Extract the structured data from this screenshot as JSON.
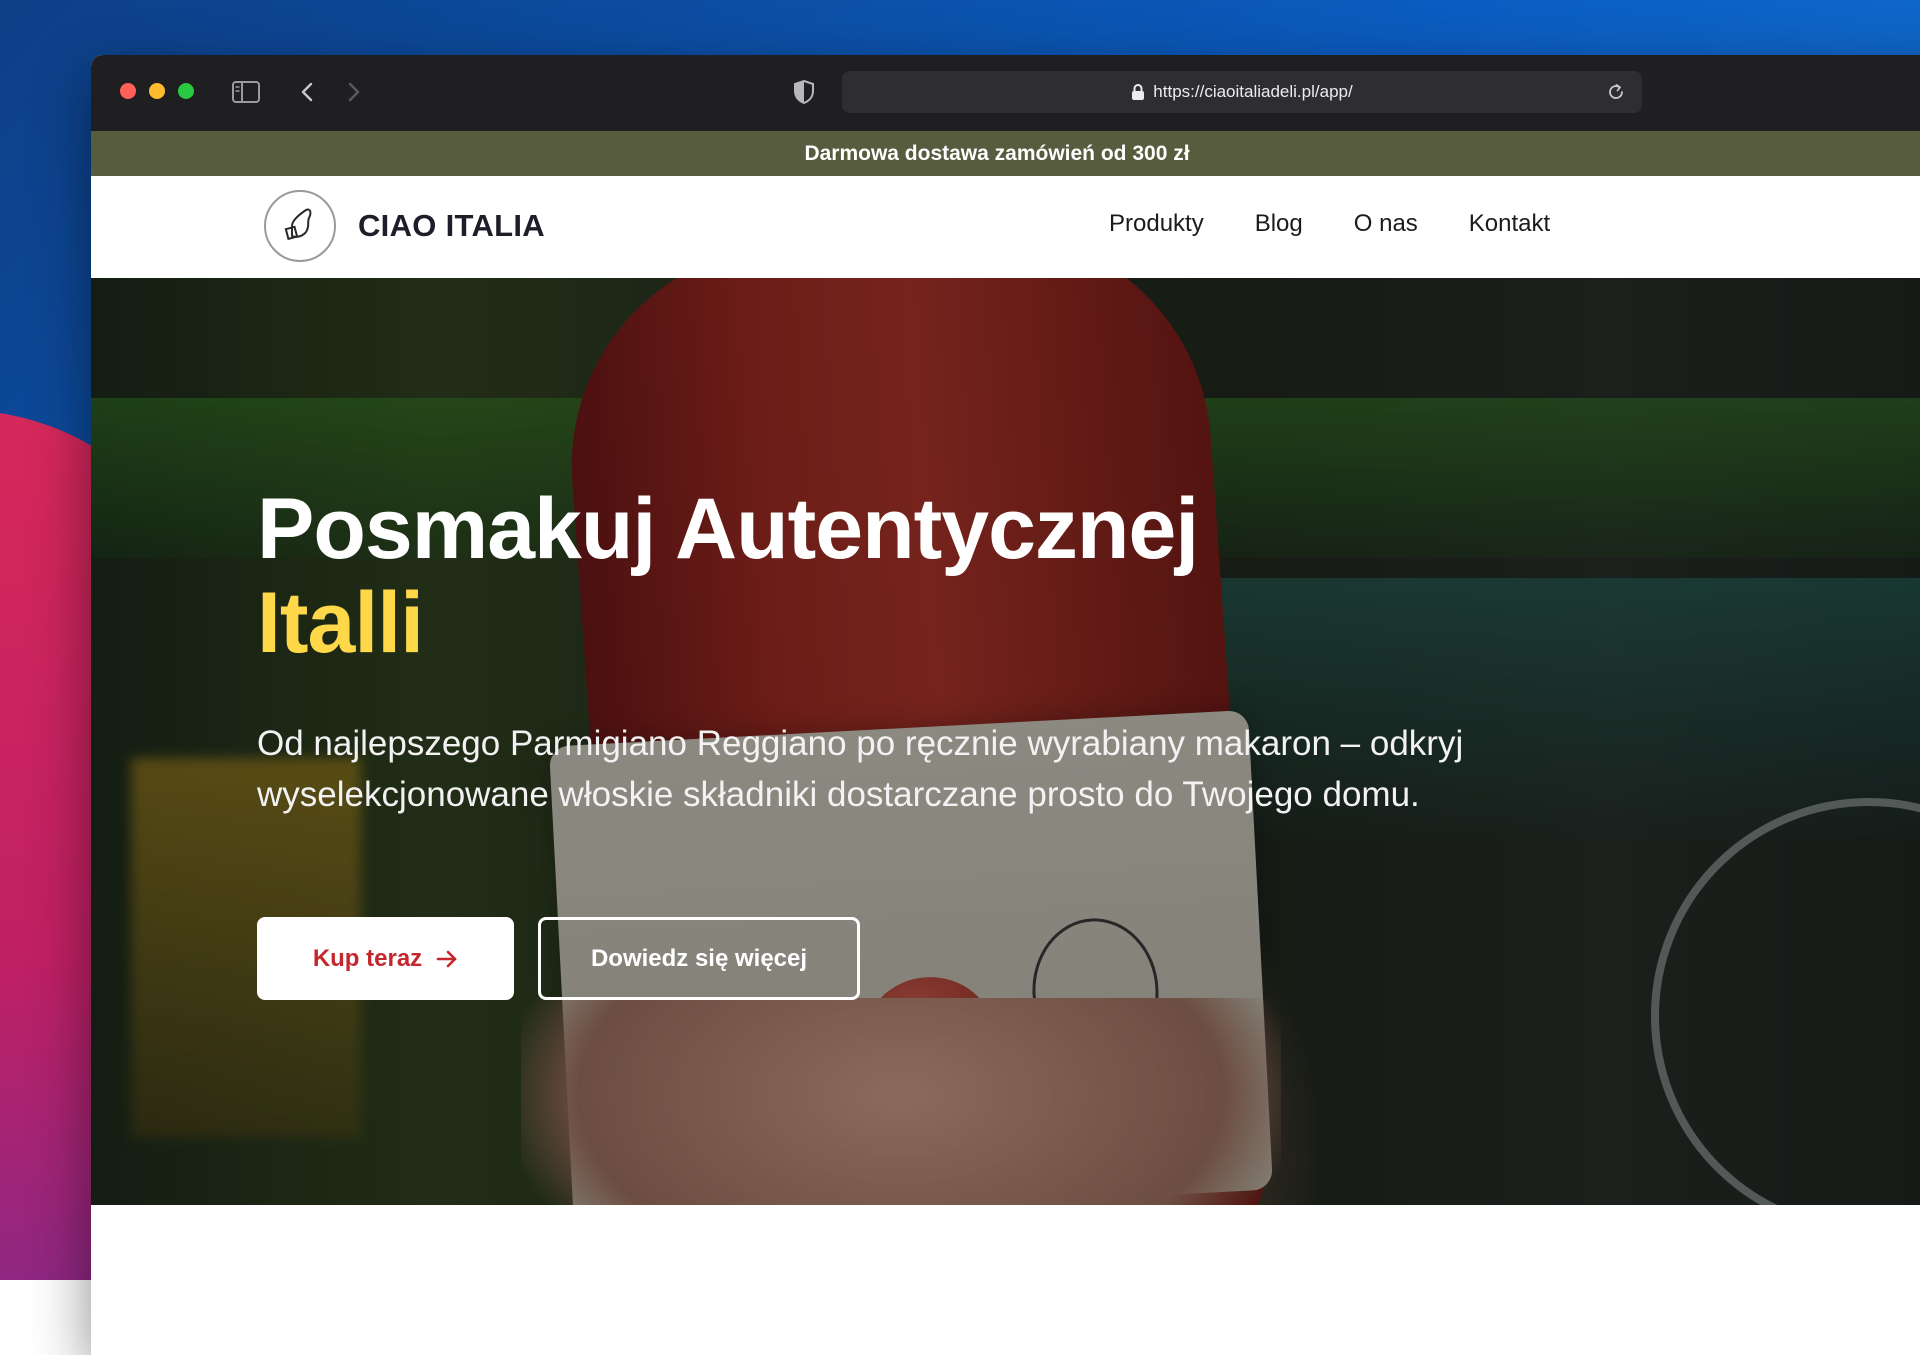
{
  "browser": {
    "url": "https://ciaoitaliadeli.pl/app/"
  },
  "promo_bar": {
    "text": "Darmowa dostawa zamówień od 300 zł"
  },
  "header": {
    "logo_text": "CIAO ITALIA",
    "logo_badge_text": "CIAO ITALIA",
    "nav": [
      {
        "label": "Produkty"
      },
      {
        "label": "Blog"
      },
      {
        "label": "O nas"
      },
      {
        "label": "Kontakt"
      }
    ]
  },
  "hero": {
    "title_line1": "Posmakuj Autentycznej",
    "title_line2": "Italli",
    "subtitle": "Od najlepszego Parmigiano Reggiano po ręcznie wyrabiany makaron – odkryj wyselekcjonowane włoskie składniki dostarczane prosto do Twojego domu.",
    "primary_button": "Kup teraz",
    "secondary_button": "Dowiedz się więcej"
  },
  "colors": {
    "promo_bg": "#565c3d",
    "accent_yellow": "#ffd84a",
    "primary_button_text": "#c4272d"
  }
}
